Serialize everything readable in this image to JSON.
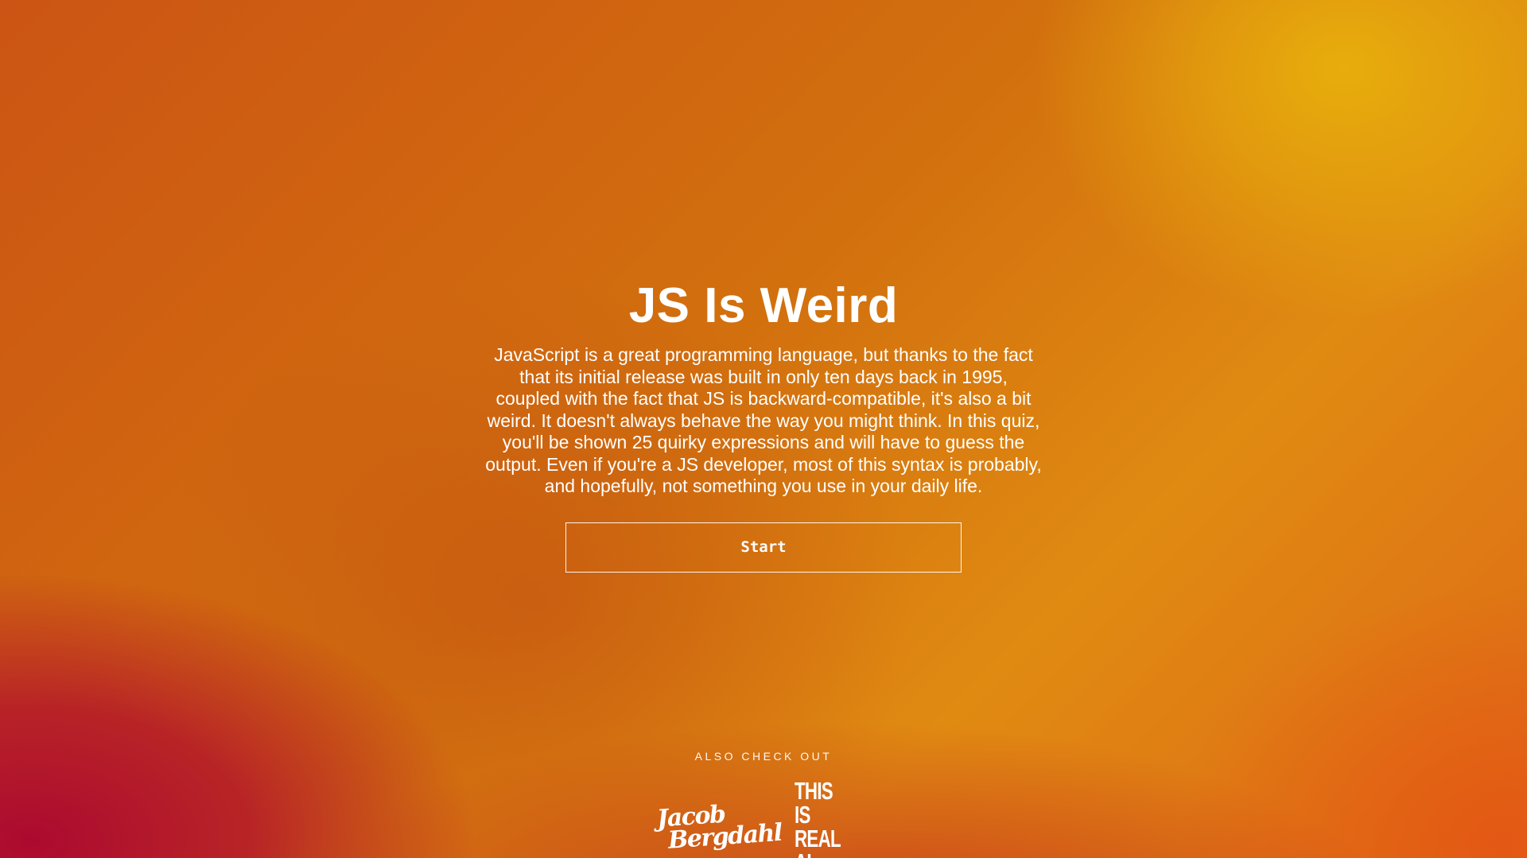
{
  "page": {
    "title": "JS Is Weird",
    "intro": "JavaScript is a great programming language, but thanks to the fact that its initial release was built in only ten days back in 1995, coupled with the fact that JS is backward-compatible, it's also a bit weird. It doesn't always behave the way you might think. In this quiz, you'll be shown 25 quirky expressions and will have to guess the output. Even if you're a JS developer, most of this syntax is probably, and hopefully, not something you use in your daily life.",
    "start_label": "Start"
  },
  "footer": {
    "also_label": "ALSO CHECK OUT",
    "logos": [
      {
        "name": "jacob-bergdahl-logo",
        "line1": "Jacob",
        "line2": "Bergdahl"
      },
      {
        "name": "this-is-real-ai-logo",
        "line1": "THIS IS",
        "line2": "REAL AI"
      }
    ]
  },
  "colors": {
    "text": "#ffffff",
    "bg_orange": "#d2700e",
    "bg_yellow": "#e8b00c",
    "bg_crimson": "#ac0a30"
  }
}
